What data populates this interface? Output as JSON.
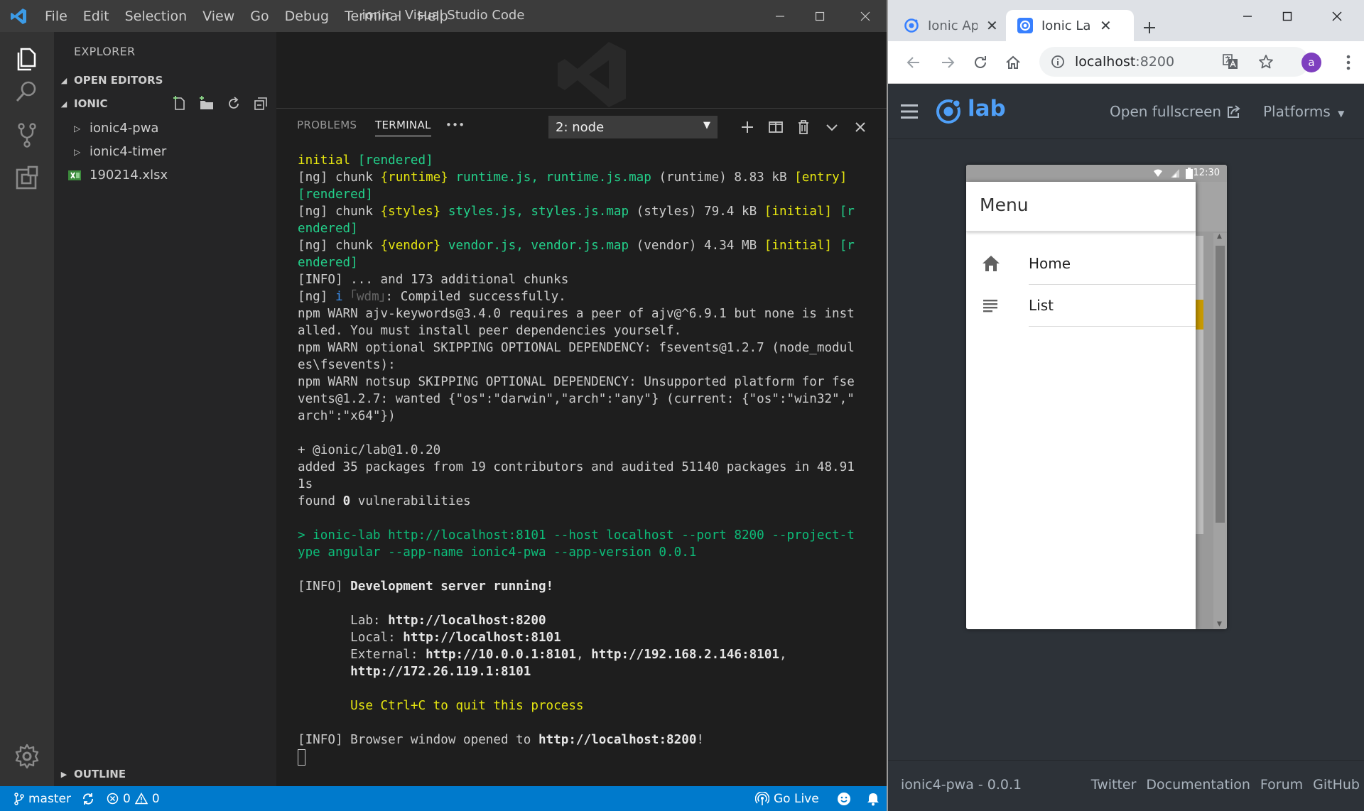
{
  "vscode": {
    "menu": [
      "File",
      "Edit",
      "Selection",
      "View",
      "Go",
      "Debug",
      "Terminal",
      "Help"
    ],
    "window_title": "ionic - Visual Studio Code",
    "explorer": {
      "title": "EXPLORER",
      "open_editors": "OPEN EDITORS",
      "folder": "IONIC",
      "items": [
        "ionic4-pwa",
        "ionic4-timer",
        "190214.xlsx"
      ],
      "outline": "OUTLINE"
    },
    "panel": {
      "tabs": [
        "PROBLEMS",
        "TERMINAL"
      ],
      "more": "•••",
      "terminal_select": "2: node"
    },
    "status": {
      "branch": "master",
      "errors": "0",
      "warnings": "0",
      "go_live": "Go Live"
    }
  },
  "terminal_lines": [
    [
      [
        "y",
        "initial"
      ],
      [
        "",
        " "
      ],
      [
        "g",
        "[rendered]"
      ]
    ],
    [
      [
        "",
        "[ng] chunk "
      ],
      [
        "y",
        "{runtime}"
      ],
      [
        "g",
        " runtime.js, runtime.js.map"
      ],
      [
        "",
        " (runtime) 8.83 kB "
      ],
      [
        "y",
        "[entry]"
      ]
    ],
    [
      [
        "g",
        "[rendered]"
      ]
    ],
    [
      [
        "",
        "[ng] chunk "
      ],
      [
        "y",
        "{styles}"
      ],
      [
        "g",
        " styles.js, styles.js.map"
      ],
      [
        "",
        " (styles) 79.4 kB "
      ],
      [
        "y",
        "[initial]"
      ],
      [
        "",
        " "
      ],
      [
        "g",
        "[r"
      ]
    ],
    [
      [
        "g",
        "endered]"
      ]
    ],
    [
      [
        "",
        "[ng] chunk "
      ],
      [
        "y",
        "{vendor}"
      ],
      [
        "g",
        " vendor.js, vendor.js.map"
      ],
      [
        "",
        " (vendor) 4.34 MB "
      ],
      [
        "y",
        "[initial]"
      ],
      [
        "",
        " "
      ],
      [
        "g",
        "[r"
      ]
    ],
    [
      [
        "g",
        "endered]"
      ]
    ],
    [
      [
        "",
        "[INFO] ... and 173 additional chunks"
      ]
    ],
    [
      [
        "",
        "[ng] "
      ],
      [
        "bl",
        "i"
      ],
      [
        "",
        " "
      ],
      [
        "dim",
        "｢wdm｣"
      ],
      [
        "",
        ": Compiled successfully."
      ]
    ],
    [
      [
        "",
        "npm WARN ajv-keywords@3.4.0 requires a peer of ajv@^6.9.1 but none is inst"
      ]
    ],
    [
      [
        "",
        "alled. You must install peer dependencies yourself."
      ]
    ],
    [
      [
        "",
        "npm WARN optional SKIPPING OPTIONAL DEPENDENCY: fsevents@1.2.7 (node_modul"
      ]
    ],
    [
      [
        "",
        "es\\fsevents):"
      ]
    ],
    [
      [
        "",
        "npm WARN notsup SKIPPING OPTIONAL DEPENDENCY: Unsupported platform for fse"
      ]
    ],
    [
      [
        "",
        "vents@1.2.7: wanted {\"os\":\"darwin\",\"arch\":\"any\"} (current: {\"os\":\"win32\",\""
      ]
    ],
    [
      [
        "",
        "arch\":\"x64\"})"
      ]
    ],
    [],
    [
      [
        "",
        "+ @ionic/lab@1.0.20"
      ]
    ],
    [
      [
        "",
        "added 35 packages from 19 contributors and audited 51140 packages in 48.91"
      ]
    ],
    [
      [
        "",
        "1s"
      ]
    ],
    [
      [
        "",
        "found "
      ],
      [
        "b",
        "0"
      ],
      [
        "",
        " vulnerabilities"
      ]
    ],
    [],
    [
      [
        "gn",
        "> ionic-lab http://localhost:8101 --host localhost --port 8200 --project-t"
      ]
    ],
    [
      [
        "gn",
        "ype angular --app-name ionic4-pwa --app-version 0.0.1"
      ]
    ],
    [],
    [
      [
        "",
        "[INFO] "
      ],
      [
        "b",
        "Development server running!"
      ]
    ],
    [],
    [
      [
        "",
        "       Lab: "
      ],
      [
        "b",
        "http://localhost:8200"
      ]
    ],
    [
      [
        "",
        "       Local: "
      ],
      [
        "b",
        "http://localhost:8101"
      ]
    ],
    [
      [
        "",
        "       External: "
      ],
      [
        "b",
        "http://10.0.0.1:8101"
      ],
      [
        "",
        ", "
      ],
      [
        "b",
        "http://192.168.2.146:8101"
      ],
      [
        "",
        ","
      ]
    ],
    [
      [
        "b",
        "       http://172.26.119.1:8101"
      ]
    ],
    [],
    [
      [
        "y",
        "       Use Ctrl+C to quit this process"
      ]
    ],
    [],
    [
      [
        "",
        "[INFO] Browser window opened to "
      ],
      [
        "b",
        "http://localhost:8200"
      ],
      [
        "",
        "!"
      ]
    ],
    []
  ],
  "chrome": {
    "tabs": [
      {
        "title": "Ionic App"
      },
      {
        "title": "Ionic Lab"
      }
    ],
    "url_host": "localhost",
    "url_port": ":8200",
    "avatar": "a"
  },
  "lab": {
    "logo_word": "lab",
    "open_fullscreen": "Open fullscreen",
    "platforms": "Platforms",
    "device": {
      "time": "12:30",
      "menu_title": "Menu",
      "items": [
        {
          "label": "Home",
          "icon": "home-icon"
        },
        {
          "label": "List",
          "icon": "list-icon"
        }
      ]
    },
    "footer": {
      "app_version": "ionic4-pwa - 0.0.1",
      "links": [
        "Twitter",
        "Documentation",
        "Forum",
        "GitHub"
      ]
    }
  },
  "colors": {
    "vscode_blue": "#007acc",
    "ionic_blue": "#4f9ff7",
    "terminal_yellow": "#e5e510",
    "terminal_green": "#23d18b"
  }
}
